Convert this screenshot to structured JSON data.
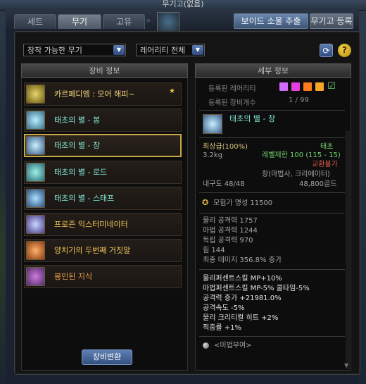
{
  "window": {
    "title": "무기고(없음)"
  },
  "tabs": [
    {
      "label": "세트",
      "active": false
    },
    {
      "label": "무기",
      "active": true
    },
    {
      "label": "고유",
      "active": false
    }
  ],
  "top_buttons": {
    "void_extract": "보이드 소울 추출",
    "register": "무기고 등록"
  },
  "filters": {
    "equip_filter": "장착 가능한 무기",
    "rarity_filter": "레어리티 전체"
  },
  "left_panel": {
    "header": "장비 정보",
    "items": [
      {
        "name": "카르페디엠 : 모어 해피~",
        "rarity": "legend",
        "starred": true,
        "selected": false,
        "icon": "sword-icon"
      },
      {
        "name": "태초의 별 - 봉",
        "rarity": "epic",
        "starred": false,
        "selected": false,
        "icon": "staff-icon"
      },
      {
        "name": "태초의 별 - 창",
        "rarity": "epic",
        "starred": false,
        "selected": true,
        "icon": "spear-icon"
      },
      {
        "name": "태초의 별 - 로드",
        "rarity": "epic",
        "starred": false,
        "selected": false,
        "icon": "rod-icon"
      },
      {
        "name": "태초의 별 - 스태프",
        "rarity": "epic",
        "starred": false,
        "selected": false,
        "icon": "staff-icon"
      },
      {
        "name": "프로즌 익스터미네이터",
        "rarity": "unique",
        "starred": false,
        "selected": false,
        "icon": "frozen-weapon-icon"
      },
      {
        "name": "양치기의 두번째 거짓말",
        "rarity": "unique",
        "starred": false,
        "selected": false,
        "icon": "shepherd-weapon-icon"
      },
      {
        "name": "봉인된 지식",
        "rarity": "rare",
        "starred": false,
        "selected": false,
        "icon": "book-icon"
      }
    ],
    "change_button": "장비변환"
  },
  "right_panel": {
    "header": "세부 정보",
    "registered_rarity_label": "등록된 레어리티",
    "registered_count_label": "등록된 장비개수",
    "registered_count": "1 / 99",
    "rarity_swatches": [
      "#cf6bff",
      "#e63ee0",
      "#ff7a1a",
      "#f4a52a"
    ],
    "detail": {
      "name": "태초의 별 - 창",
      "grade": "최상급(100%)",
      "rarity_text": "태초",
      "weight": "3.2kg",
      "level_limit": "레벨제한 100 (115 - 15)",
      "trade": "교환불가",
      "class": "창(마법사, 크리에이터)",
      "durability": "내구도 48/48",
      "price": "48,800골드",
      "fame": "모험가 명성 11500",
      "stats": [
        "물리 공격력 1757",
        "마법 공격력 1244",
        "독립 공격력 970",
        "힘 144",
        "최종 데미지 356.8% 증가"
      ],
      "options": [
        "물리퍼센트스킬 MP+10%",
        "마법퍼센트스킬 MP-5% 쿨타임-5%",
        "공격력 증가 +21981.0%",
        "공격속도 -5%",
        "물리 크리티컬 히트 +2%",
        "적중률 +1%"
      ],
      "enchant": "<미법부여>"
    }
  },
  "colors": {
    "legend": "#f0d27a",
    "epic": "#7fe3d0",
    "unique": "#f0c45a",
    "rare": "#e89b4a",
    "selection_border": "#c9a84a",
    "accent_button": "#5f80b4"
  }
}
